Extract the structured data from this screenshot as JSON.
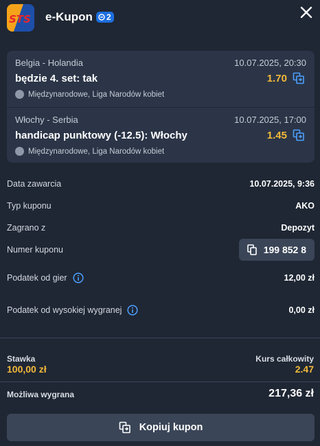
{
  "header": {
    "logo_text": "STS",
    "title": "e-Kupon",
    "badge_count": "2"
  },
  "bets": [
    {
      "match": "Belgia - Holandia",
      "date": "10.07.2025, 20:30",
      "pick": "będzie 4. set: tak",
      "odds": "1.70",
      "league": "Międzynarodowe, Liga Narodów kobiet"
    },
    {
      "match": "Włochy - Serbia",
      "date": "10.07.2025, 17:00",
      "pick": "handicap punktowy (-12.5): Włochy",
      "odds": "1.45",
      "league": "Międzynarodowe, Liga Narodów kobiet"
    }
  ],
  "details": {
    "date_label": "Data zawarcia",
    "date_value": "10.07.2025, 9:36",
    "type_label": "Typ kuponu",
    "type_value": "AKO",
    "played_label": "Zagrano z",
    "played_value": "Depozyt",
    "number_label": "Numer kuponu",
    "number_value": "199 852 8",
    "tax_label": "Podatek od gier",
    "tax_value": "12,00 zł",
    "high_tax_label": "Podatek od wysokiej wygranej",
    "high_tax_value": "0,00 zł"
  },
  "summary": {
    "stake_label": "Stawka",
    "stake_value": "100,00 zł",
    "odds_label": "Kurs całkowity",
    "odds_value": "2.47",
    "win_label": "Możliwa wygrana",
    "win_value": "217,36 zł"
  },
  "actions": {
    "copy_label": "Kopiuj kupon"
  },
  "colors": {
    "background": "#1f2734",
    "card": "#2b3547",
    "accent_odds": "#f4b93a",
    "badge": "#1d6fe0",
    "icon_blue": "#4d9fff"
  }
}
